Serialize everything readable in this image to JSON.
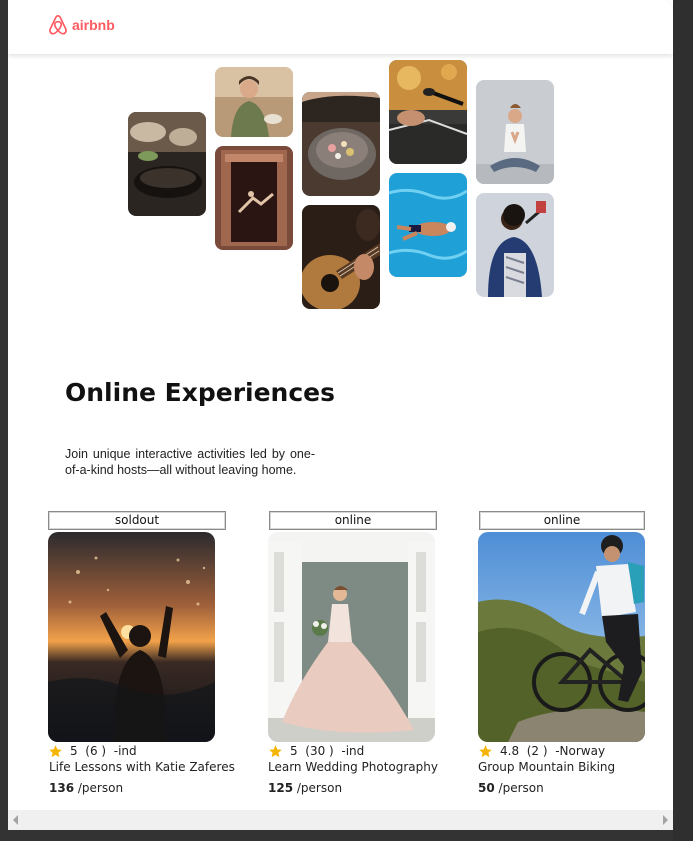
{
  "brand": {
    "name": "airbnb",
    "color": "#FF5A5F"
  },
  "hero": {
    "tiles": [
      {
        "icon": "cooking-pan-photo"
      },
      {
        "icon": "chef-woman-photo"
      },
      {
        "icon": "dancer-doorway-photo"
      },
      {
        "icon": "food-bowl-photo"
      },
      {
        "icon": "guitar-photo"
      },
      {
        "icon": "singer-microphone-photo"
      },
      {
        "icon": "swimmer-pool-photo"
      },
      {
        "icon": "yoga-woman-photo"
      },
      {
        "icon": "singer-man-photo"
      }
    ]
  },
  "main": {
    "heading": "Online Experiences",
    "description": "Join unique interactive activities led by one-of-a-kind hosts—all without leaving home."
  },
  "accent": {
    "star": "#F5B400"
  },
  "cards": [
    {
      "badge": "soldout",
      "rating": "5",
      "count": "(6 )",
      "location": "-ind",
      "title": "Life Lessons with Katie Zaferes",
      "price": "136",
      "unit": "/person",
      "photo": "swimmer-sunset-photo"
    },
    {
      "badge": "online",
      "rating": "5",
      "count": "(30 )",
      "location": "-ind",
      "title": "Learn Wedding Photography",
      "price": "125",
      "unit": "/person",
      "photo": "bride-dress-photo"
    },
    {
      "badge": "online",
      "rating": "4.8",
      "count": "(2 )",
      "location": "-Norway",
      "title": "Group Mountain Biking",
      "price": "50",
      "unit": "/person",
      "photo": "mountain-biker-photo"
    }
  ]
}
